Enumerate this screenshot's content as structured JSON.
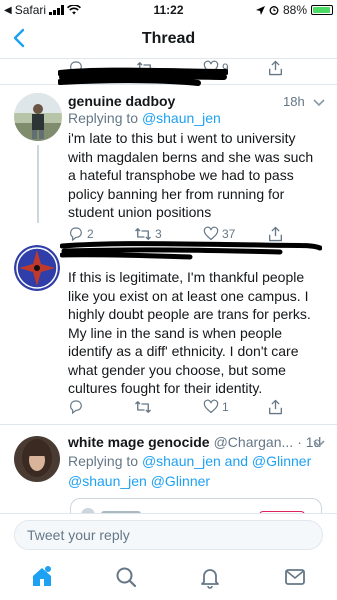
{
  "status_bar": {
    "carrier": "Safari",
    "time": "11:22",
    "battery": "88%"
  },
  "nav": {
    "title": "Thread"
  },
  "top_actions": {
    "like_count": "9"
  },
  "tweets": [
    {
      "name": "genuine dadboy",
      "time": "18h",
      "replying_prefix": "Replying to",
      "replying_handles": "@shaun_jen",
      "text": "i'm late to this but i went to university with magdalen berns and she was such a hateful transphobe we had to pass policy banning her from running for student union positions",
      "replies": "2",
      "retweets": "3",
      "likes": "37"
    },
    {
      "text": "If this is legitimate, I'm thankful people like you exist on at least one campus. I highly doubt people are trans for perks. My line in the sand is when people identify as a diff' ethnicity. I don't care what gender you choose, but some cultures fought for their identity.",
      "likes": "1"
    },
    {
      "name": "white mage genocide",
      "handle": "@Chargan...",
      "time": "· 1d",
      "replying_prefix": "Replying to",
      "replying_handles": "@shaun_jen and @Glinner",
      "mentions": "@shaun_jen @Glinner"
    }
  ],
  "composer": {
    "placeholder": "Tweet your reply"
  },
  "tabbar": {
    "items": [
      "home-icon",
      "search-icon",
      "notifications-icon",
      "messages-icon"
    ]
  },
  "colors": {
    "accent": "#1da1f2",
    "muted": "#657786",
    "text": "#14171a",
    "divider": "#e1e8ed"
  }
}
